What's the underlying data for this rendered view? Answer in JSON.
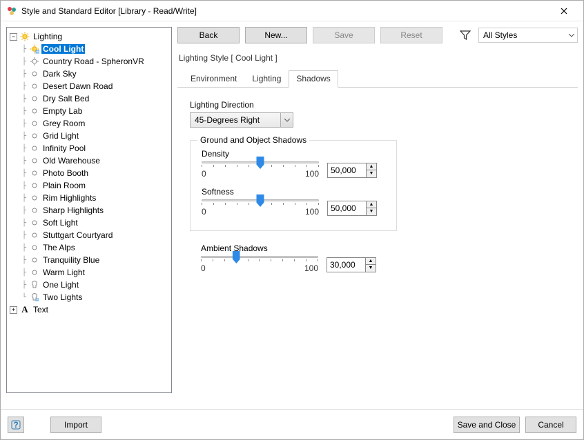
{
  "window": {
    "title": "Style and Standard Editor [Library - Read/Write]"
  },
  "toolbar": {
    "back": "Back",
    "new": "New...",
    "save": "Save",
    "reset": "Reset",
    "styleFilter": "All Styles"
  },
  "tree": {
    "root": "Lighting",
    "items": [
      "Cool Light",
      "Country Road - SpheronVR",
      "Dark Sky",
      "Desert Dawn Road",
      "Dry Salt Bed",
      "Empty Lab",
      "Grey Room",
      "Grid Light",
      "Infinity Pool",
      "Old Warehouse",
      "Photo Booth",
      "Plain Room",
      "Rim Highlights",
      "Sharp Highlights",
      "Soft Light",
      "Stuttgart Courtyard",
      "The Alps",
      "Tranquility Blue",
      "Warm Light",
      "One Light",
      "Two Lights"
    ],
    "textRoot": "Text"
  },
  "styleTitle": "Lighting Style [ Cool Light ]",
  "tabs": {
    "environment": "Environment",
    "lighting": "Lighting",
    "shadows": "Shadows"
  },
  "shadows": {
    "directionLabel": "Lighting Direction",
    "directionValue": "45-Degrees Right",
    "groupTitle": "Ground and Object Shadows",
    "densityLabel": "Density",
    "densityValue": "50,000",
    "softnessLabel": "Softness",
    "softnessValue": "50,000",
    "ambientLabel": "Ambient Shadows",
    "ambientValue": "30,000",
    "scaleMin": "0",
    "scaleMax": "100"
  },
  "footer": {
    "import": "Import",
    "saveClose": "Save and Close",
    "cancel": "Cancel"
  }
}
